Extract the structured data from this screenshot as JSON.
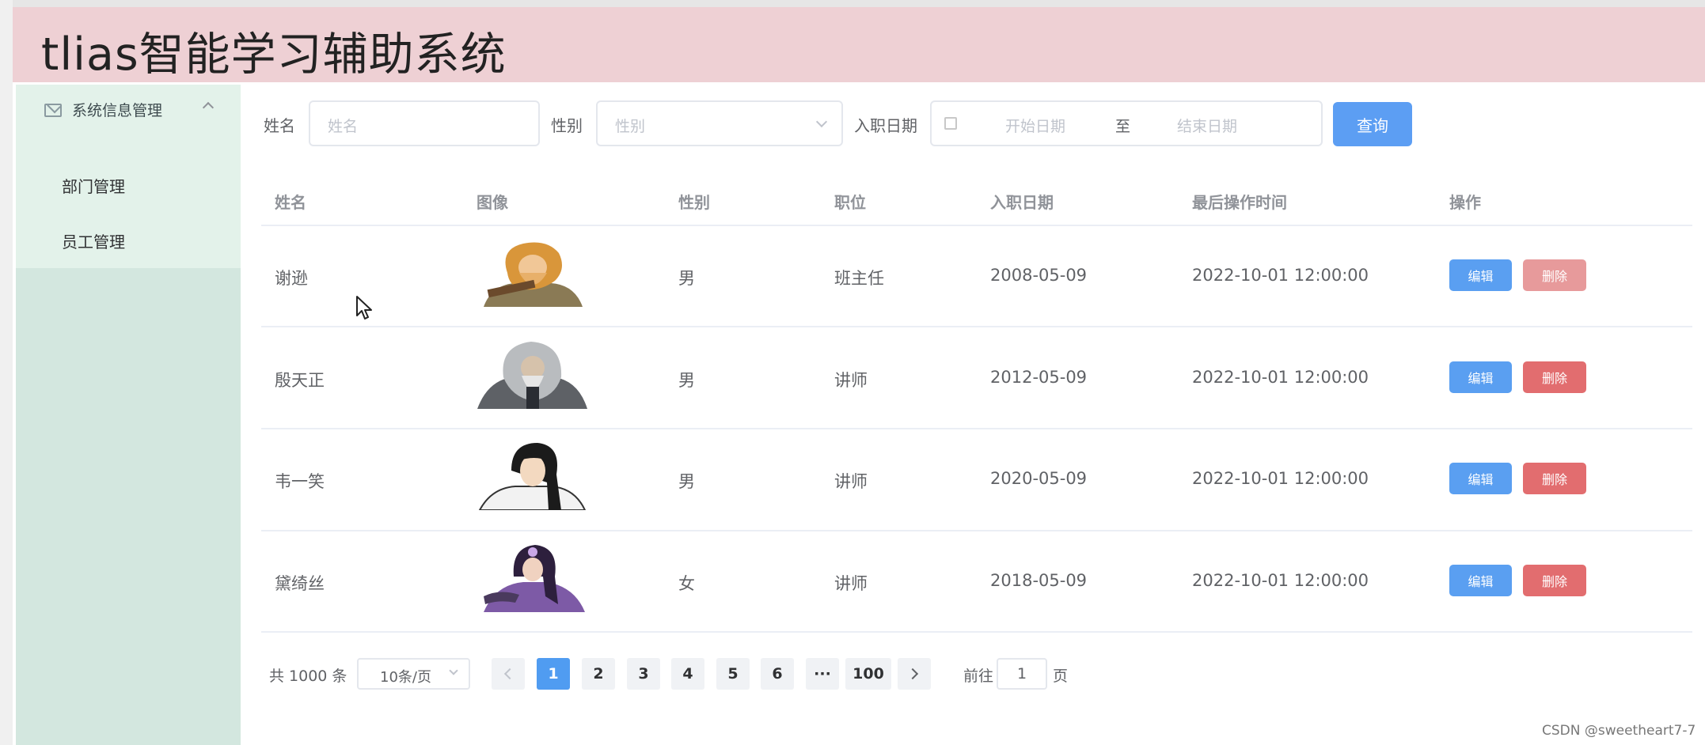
{
  "header": {
    "title": "tlias智能学习辅助系统"
  },
  "sidebar": {
    "group_label": "系统信息管理",
    "items": [
      {
        "label": "部门管理"
      },
      {
        "label": "员工管理"
      }
    ]
  },
  "filters": {
    "name_label": "姓名",
    "name_placeholder": "姓名",
    "gender_label": "性别",
    "gender_placeholder": "性别",
    "date_label": "入职日期",
    "start_placeholder": "开始日期",
    "range_separator": "至",
    "end_placeholder": "结束日期",
    "query_button": "查询"
  },
  "table": {
    "columns": [
      "姓名",
      "图像",
      "性别",
      "职位",
      "入职日期",
      "最后操作时间",
      "操作"
    ],
    "rows": [
      {
        "name": "谢逊",
        "gender": "男",
        "position": "班主任",
        "entry_date": "2008-05-09",
        "updated": "2022-10-01 12:00:00",
        "edit": "编辑",
        "delete": "删除"
      },
      {
        "name": "殷天正",
        "gender": "男",
        "position": "讲师",
        "entry_date": "2012-05-09",
        "updated": "2022-10-01 12:00:00",
        "edit": "编辑",
        "delete": "删除"
      },
      {
        "name": "韦一笑",
        "gender": "男",
        "position": "讲师",
        "entry_date": "2020-05-09",
        "updated": "2022-10-01 12:00:00",
        "edit": "编辑",
        "delete": "删除"
      },
      {
        "name": "黛绮丝",
        "gender": "女",
        "position": "讲师",
        "entry_date": "2018-05-09",
        "updated": "2022-10-01 12:00:00",
        "edit": "编辑",
        "delete": "删除"
      }
    ]
  },
  "pagination": {
    "total": "共 1000 条",
    "page_size": "10条/页",
    "pages": [
      "1",
      "2",
      "3",
      "4",
      "5",
      "6",
      "···",
      "100"
    ],
    "current_page": "1",
    "goto_label": "前往",
    "goto_value": "1",
    "goto_suffix": "页"
  },
  "watermark": "CSDN @sweetheart7-7",
  "colors": {
    "header_bg": "#eed0d4",
    "sidebar_bg": "#d3e7df",
    "primary": "#5c9ef3",
    "danger": "#e26d6f"
  }
}
